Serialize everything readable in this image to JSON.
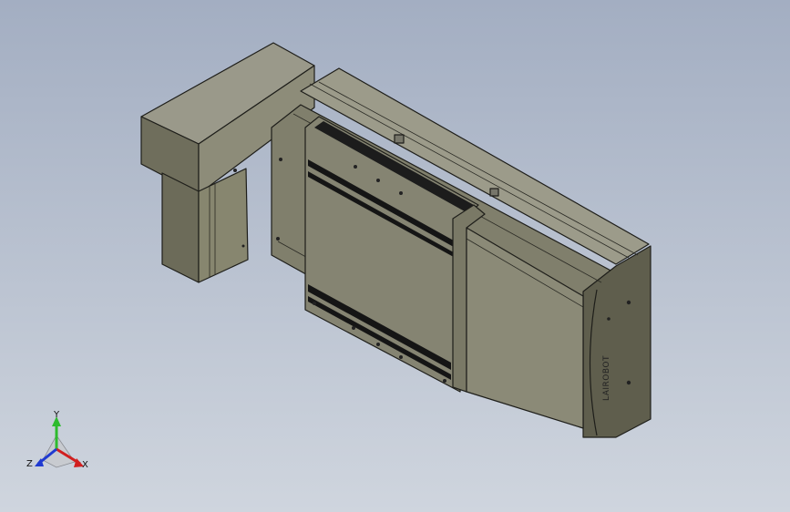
{
  "viewport": {
    "background_top": "#a3aec2",
    "background_bottom": "#cfd5de"
  },
  "model": {
    "body_color": "#7e7d6c",
    "face_dark": "#64634f",
    "face_light": "#8f8e7c",
    "slot_color": "#151515",
    "brand_mark": "LAIROBOT"
  },
  "triad": {
    "x_label": "X",
    "y_label": "Y",
    "z_label": "Z",
    "x_color": "#d11f1f",
    "y_color": "#2ebb2e",
    "z_color": "#1f3ad1"
  }
}
